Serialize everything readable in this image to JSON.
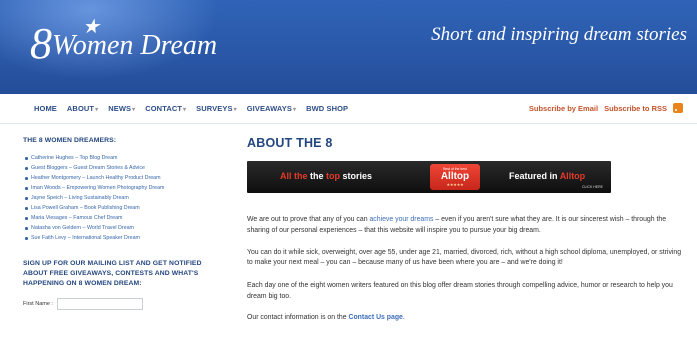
{
  "header": {
    "logo_digit": "8",
    "logo_text": "Women Dream",
    "tagline": "Short and inspiring dream stories"
  },
  "nav": {
    "items": [
      {
        "label": "HOME",
        "dropdown": false
      },
      {
        "label": "ABOUT",
        "dropdown": true
      },
      {
        "label": "NEWS",
        "dropdown": true
      },
      {
        "label": "CONTACT",
        "dropdown": true
      },
      {
        "label": "SURVEYS",
        "dropdown": true
      },
      {
        "label": "GIVEAWAYS",
        "dropdown": true
      },
      {
        "label": "BWD SHOP",
        "dropdown": false
      }
    ],
    "subscribe_email": "Subscribe by Email",
    "subscribe_rss": "Subscribe to RSS"
  },
  "sidebar": {
    "heading": "THE 8 WOMEN DREAMERS:",
    "dreamers": [
      "Catherine Hughes – Top Blog Dream",
      "Guest Bloggers – Guest Dream Stories & Advice",
      "Heather Montgomery – Launch Healthy Product Dream",
      "Iman Woods – Empowering Women Photography Dream",
      "Jayne Speich – Living Sustainably Dream",
      "Lisa Powell Graham – Book Publishing Dream",
      "Maria Viesages – Famous Chef Dream",
      "Natasha von Geldern – World Travel Dream",
      "Sue Faith Levy – International Speaker Dream"
    ],
    "mailing_heading": "SIGN UP FOR OUR MAILING LIST AND GET NOTIFIED ABOUT FREE GIVEAWAYS, CONTESTS AND WHAT'S HAPPENING ON 8 WOMEN DREAM:",
    "first_name_label": "First Name :"
  },
  "main": {
    "title": "ABOUT THE 8",
    "banner": {
      "all_the": "All the",
      "top": "top",
      "stories": "stories",
      "badge_small": "Best of the best",
      "badge_big": "Alltop",
      "badge_stars": "★★★★★",
      "featured_in": "Featured in",
      "alltop": "Alltop",
      "click_here": "CLICK HERE"
    },
    "p1_before": "We are out to prove that any of you can ",
    "p1_link": "achieve your dreams",
    "p1_after": " – even if you aren't sure what they are. It is our sincerest wish – through the sharing of our personal experiences – that this website will inspire you to pursue your big dream.",
    "p2": "You can do it while sick, overweight, over age 55, under age 21, married, divorced, rich, without a high school diploma, unemployed, or striving to make your next meal – you can – because many of us have been where you are – and we're doing it!",
    "p3": "Each day one of the eight women writers featured on this blog offer dream stories through compelling advice, humor or research to help you dream big too.",
    "p4_before": "Our contact information is on the ",
    "p4_link": "Contact Us page",
    "p4_after": "."
  }
}
